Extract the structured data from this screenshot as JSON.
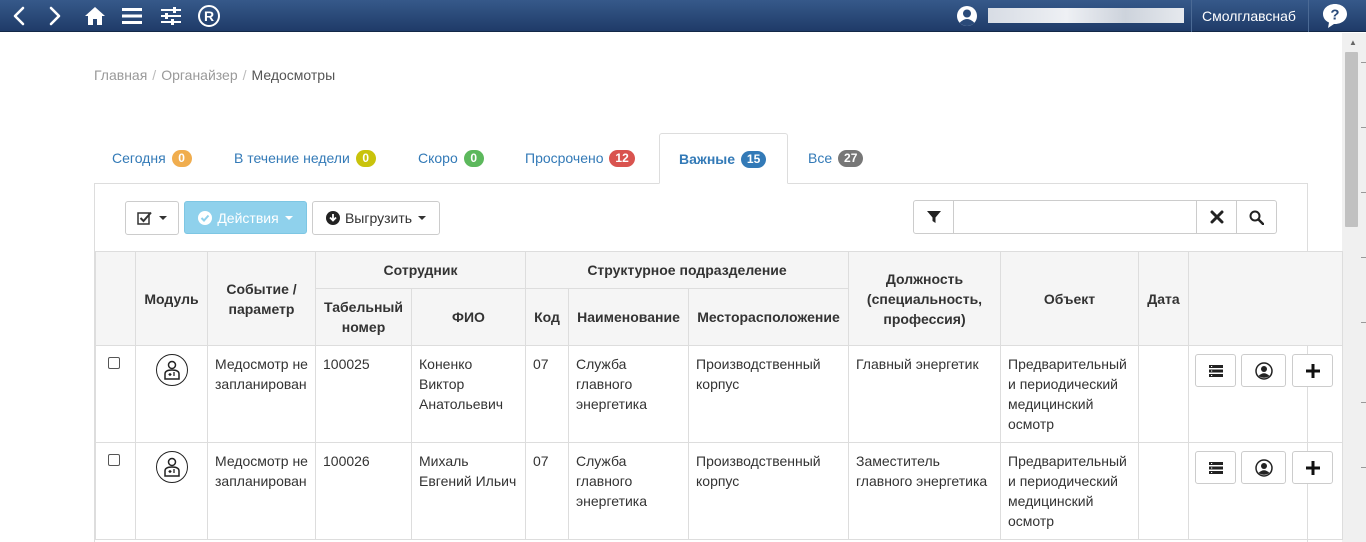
{
  "topbar": {
    "icons": [
      "back-icon",
      "forward-icon",
      "home-icon",
      "menu-icon",
      "settings-sliders-icon",
      "registered-icon"
    ],
    "org_name": "Смолглавснаб",
    "help_icon": "help-icon",
    "user_icon": "user-icon"
  },
  "breadcrumb": {
    "items": [
      "Главная",
      "Органайзер",
      "Медосмотры"
    ],
    "separator": "/"
  },
  "tabs": [
    {
      "label": "Сегодня",
      "count": "0",
      "color": "#f0ad4e"
    },
    {
      "label": "В течение недели",
      "count": "0",
      "color": "#c9c30c"
    },
    {
      "label": "Скоро",
      "count": "0",
      "color": "#5cb85c"
    },
    {
      "label": "Просрочено",
      "count": "12",
      "color": "#d9534f"
    },
    {
      "label": "Важные",
      "count": "15",
      "color": "#337ab7",
      "active": true
    },
    {
      "label": "Все",
      "count": "27",
      "color": "#777777"
    }
  ],
  "toolbar": {
    "actions_label": "Действия",
    "export_label": "Выгрузить",
    "search_value": ""
  },
  "table": {
    "headers": {
      "module": "Модуль",
      "event": "Событие / параметр",
      "employee": "Сотрудник",
      "tab_number": "Табельный номер",
      "fio": "ФИО",
      "division": "Структурное подразделение",
      "code": "Код",
      "name": "Наименование",
      "location": "Месторасположение",
      "position": "Должность (специальность, профессия)",
      "object": "Объект",
      "date": "Дата"
    },
    "rows": [
      {
        "event": "Медосмотр не запланирован",
        "tab_number": "100025",
        "fio": "Коненко Виктор Анатольевич",
        "code": "07",
        "name": "Служба главного энергетика",
        "location": "Производственный корпус",
        "position": "Главный энергетик",
        "object": "Предварительный и периодический медицинский осмотр",
        "date": ""
      },
      {
        "event": "Медосмотр не запланирован",
        "tab_number": "100026",
        "fio": "Михаль Евгений Ильич",
        "code": "07",
        "name": "Служба главного энергетика",
        "location": "Производственный корпус",
        "position": "Заместитель главного энергетика",
        "object": "Предварительный и периодический медицинский осмотр",
        "date": ""
      }
    ]
  },
  "colors": {
    "navbar": "#2a4a79",
    "link": "#337ab7",
    "actions_button": "#8fd1ec"
  }
}
